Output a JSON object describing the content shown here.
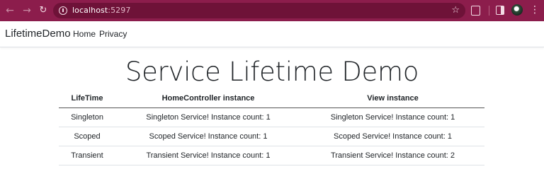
{
  "browser": {
    "url_host": "localhost",
    "url_port": ":5297"
  },
  "navbar": {
    "brand": "LifetimeDemo",
    "links": [
      "Home",
      "Privacy"
    ]
  },
  "main": {
    "title": "Service Lifetime Demo",
    "table": {
      "headers": [
        "LifeTime",
        "HomeController instance",
        "View instance"
      ],
      "rows": [
        [
          "Singleton",
          "Singleton Service! Instance count: 1",
          "Singleton Service! Instance count: 1"
        ],
        [
          "Scoped",
          "Scoped Service! Instance count: 1",
          "Scoped Service! Instance count: 1"
        ],
        [
          "Transient",
          "Transient Service! Instance count: 1",
          "Transient Service! Instance count: 2"
        ]
      ]
    }
  },
  "colors": {
    "chrome_frame": "#8c1d4c",
    "omnibox": "#6e1238",
    "text": "#212529"
  }
}
